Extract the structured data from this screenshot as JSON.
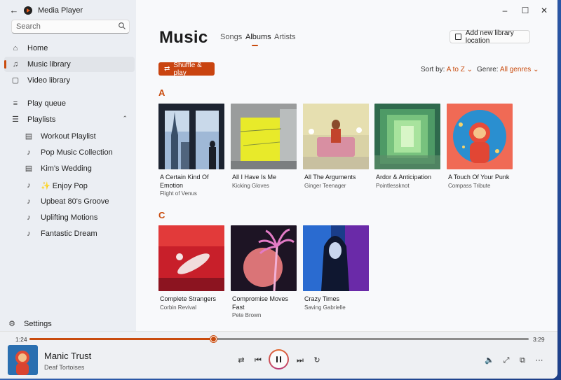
{
  "app": {
    "title": "Media Player",
    "accent": "#c94b0d"
  },
  "sidebar": {
    "search_placeholder": "Search",
    "items": [
      {
        "label": "Home",
        "icon": "home-icon"
      },
      {
        "label": "Music library",
        "icon": "music-note-icon",
        "selected": true
      },
      {
        "label": "Video library",
        "icon": "video-icon"
      },
      {
        "label": "Play queue",
        "icon": "queue-icon"
      },
      {
        "label": "Playlists",
        "icon": "playlists-icon"
      }
    ],
    "playlists": [
      {
        "label": "Workout Playlist",
        "icon": "playlist-icon"
      },
      {
        "label": "Pop Music Collection",
        "icon": "music-note-icon"
      },
      {
        "label": "Kim's Wedding",
        "icon": "playlist-icon"
      },
      {
        "label": "✨ Enjoy Pop",
        "icon": "music-note-icon"
      },
      {
        "label": "Upbeat 80's Groove",
        "icon": "music-note-icon"
      },
      {
        "label": "Uplifting Motions",
        "icon": "music-note-icon"
      },
      {
        "label": "Fantastic Dream",
        "icon": "music-note-icon"
      }
    ],
    "settings_label": "Settings"
  },
  "main": {
    "page_title": "Music",
    "tabs": [
      {
        "label": "Songs",
        "active": false
      },
      {
        "label": "Albums",
        "active": true
      },
      {
        "label": "Artists",
        "active": false
      }
    ],
    "add_library_label": "Add new library location",
    "shuffle_label": "Shuffle & play",
    "sort_prefix": "Sort by:",
    "sort_value": "A to Z",
    "genre_prefix": "Genre:",
    "genre_value": "All genres",
    "sections": [
      {
        "letter": "A",
        "albums": [
          {
            "title": "A Certain Kind Of Emotion",
            "artist": "Flight of Venus"
          },
          {
            "title": "All I Have Is Me",
            "artist": "Kicking Gloves"
          },
          {
            "title": "All The Arguments",
            "artist": "Ginger Teenager"
          },
          {
            "title": "Ardor & Anticipation",
            "artist": "Pointlessknot"
          },
          {
            "title": "A Touch Of Your Punk",
            "artist": "Compass Tribute"
          }
        ]
      },
      {
        "letter": "C",
        "albums": [
          {
            "title": "Complete Strangers",
            "artist": "Corbin Revival"
          },
          {
            "title": "Compromise Moves Fast",
            "artist": "Pete Brown"
          },
          {
            "title": "Crazy Times",
            "artist": "Saving Gabrielle"
          }
        ]
      }
    ]
  },
  "player": {
    "elapsed": "1:24",
    "duration": "3:29",
    "progress": 0.37,
    "track_title": "Manic Trust",
    "track_artist": "Deaf Tortoises"
  }
}
